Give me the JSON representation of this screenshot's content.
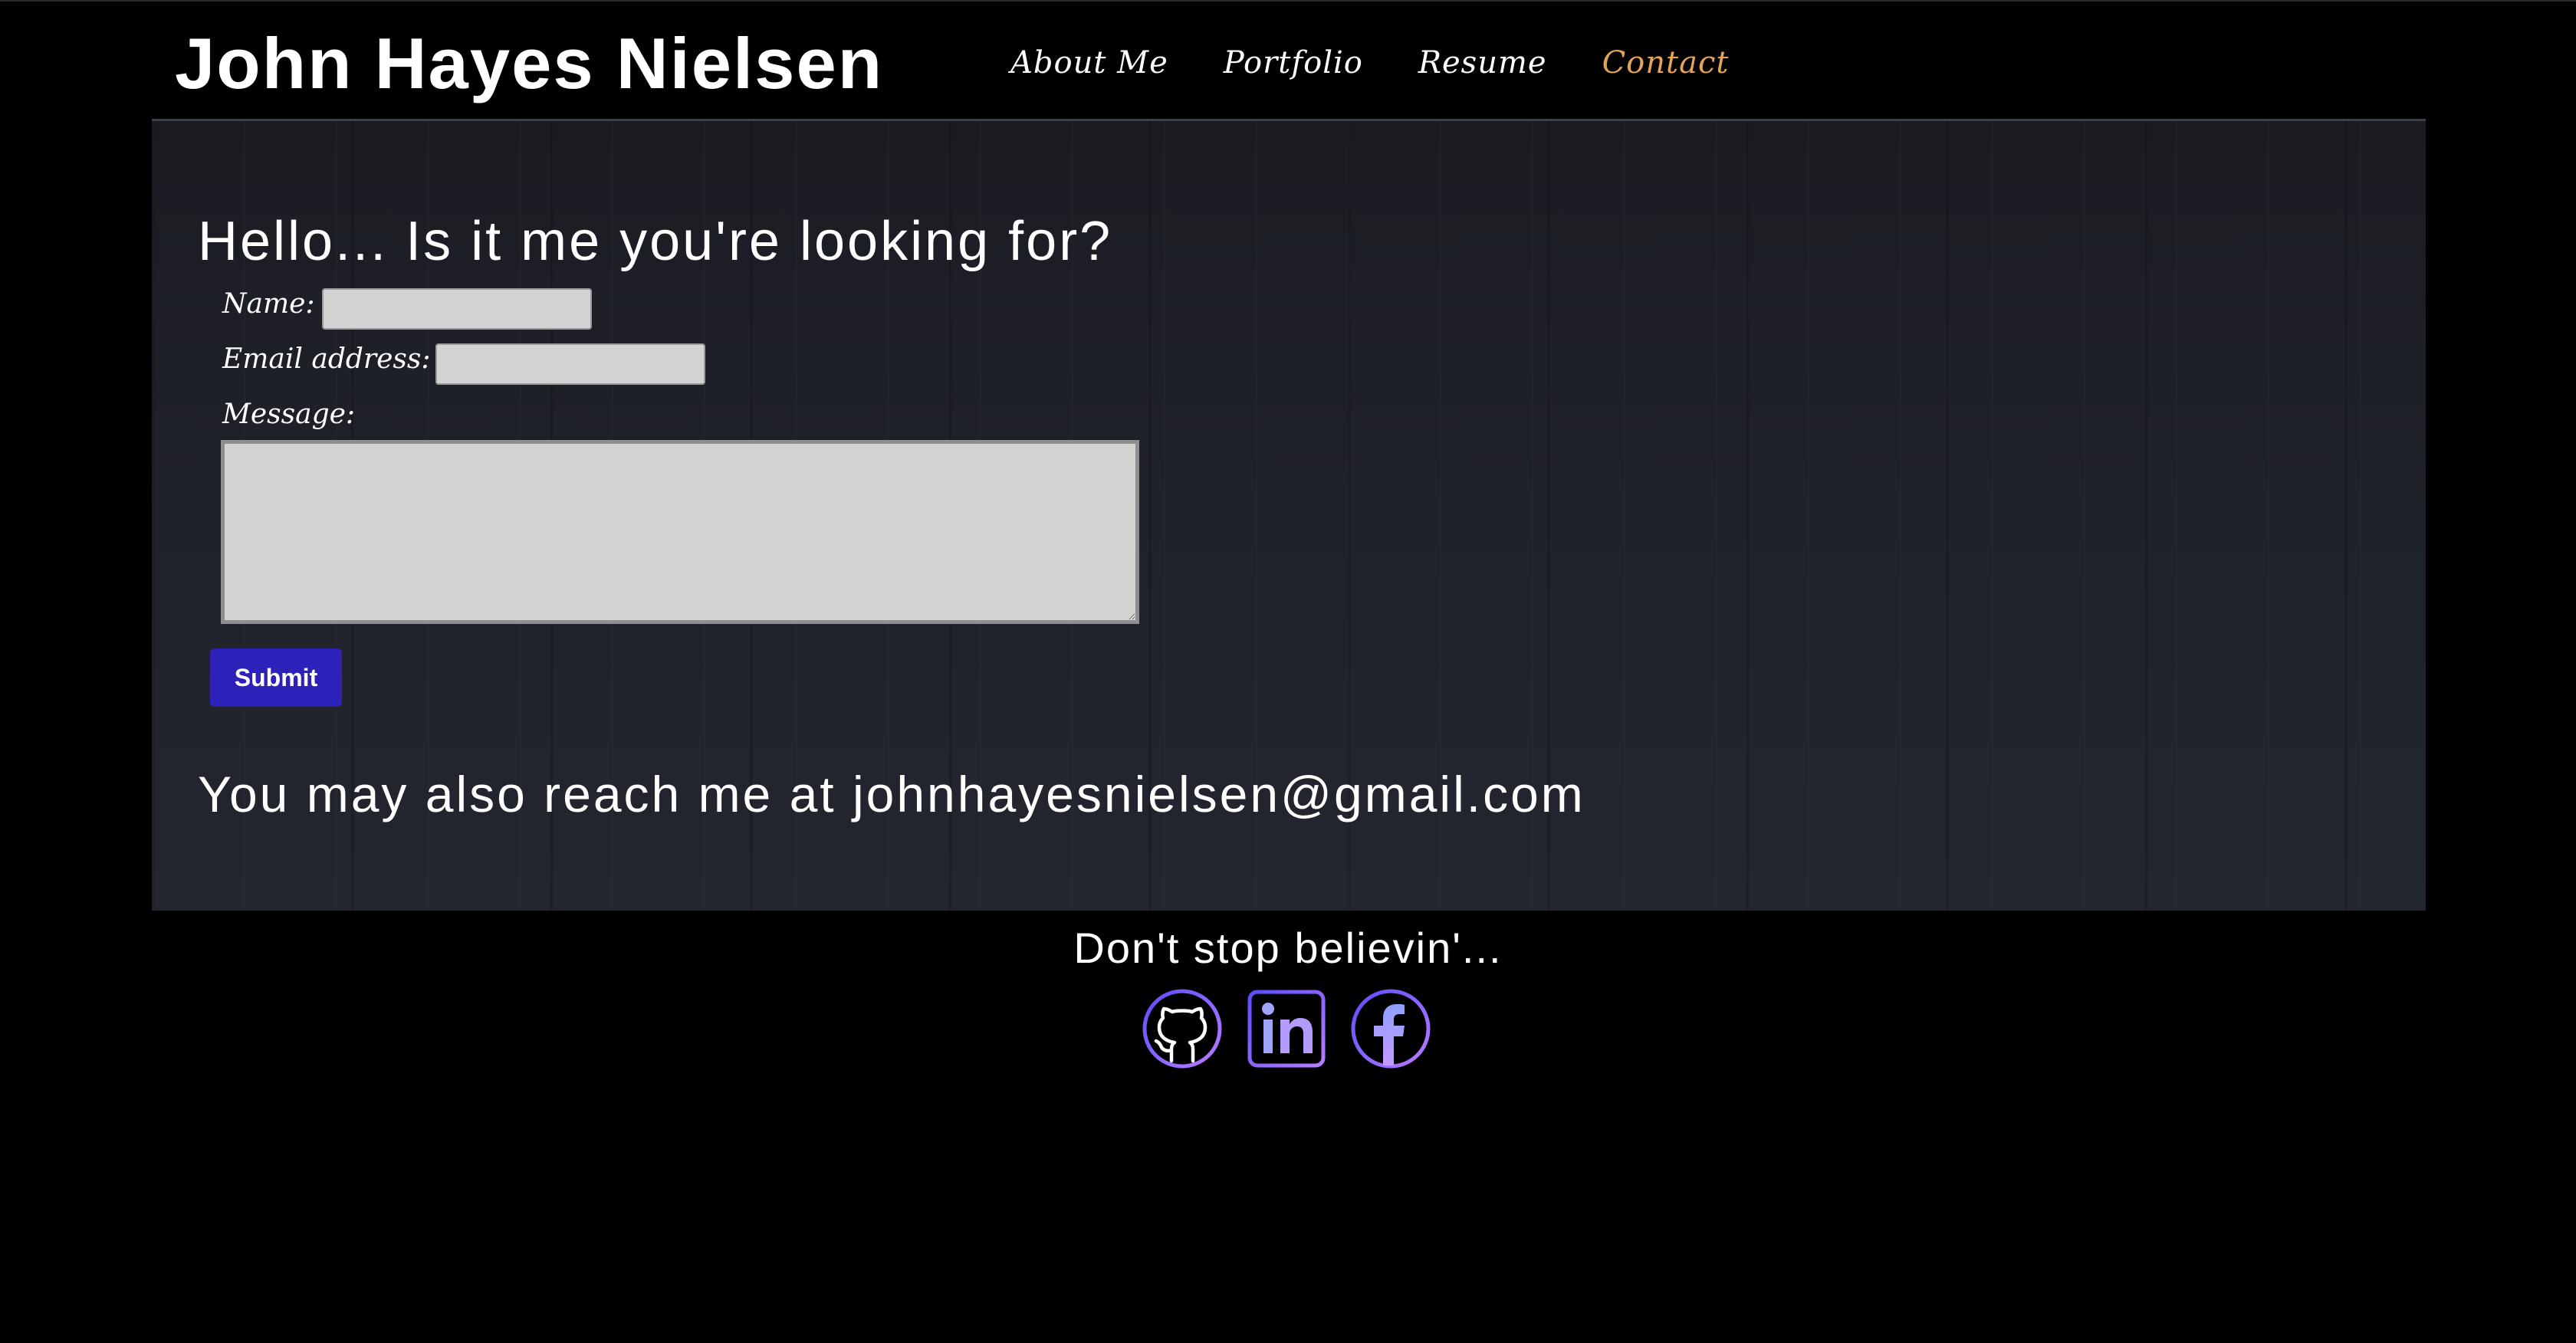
{
  "header": {
    "site_title": "John Hayes Nielsen",
    "nav": [
      {
        "label": "About Me",
        "active": false
      },
      {
        "label": "Portfolio",
        "active": false
      },
      {
        "label": "Resume",
        "active": false
      },
      {
        "label": "Contact",
        "active": true
      }
    ],
    "active_color": "#e4a35a"
  },
  "main": {
    "heading": "Hello... Is it me you're looking for?",
    "form": {
      "name_label": "Name:",
      "name_value": "",
      "email_label": "Email address:",
      "email_value": "",
      "message_label": "Message:",
      "message_value": "",
      "submit_label": "Submit",
      "submit_color": "#2c21b8"
    },
    "reach_prefix": "You may also reach me at ",
    "reach_email": "johnhayesnielsen@gmail.com"
  },
  "footer": {
    "tagline": "Don't stop believin'...",
    "social": [
      {
        "icon": "github-icon"
      },
      {
        "icon": "linkedin-icon"
      },
      {
        "icon": "facebook-icon"
      }
    ],
    "icon_gradient": [
      "#6a5cff",
      "#b07cff"
    ]
  }
}
